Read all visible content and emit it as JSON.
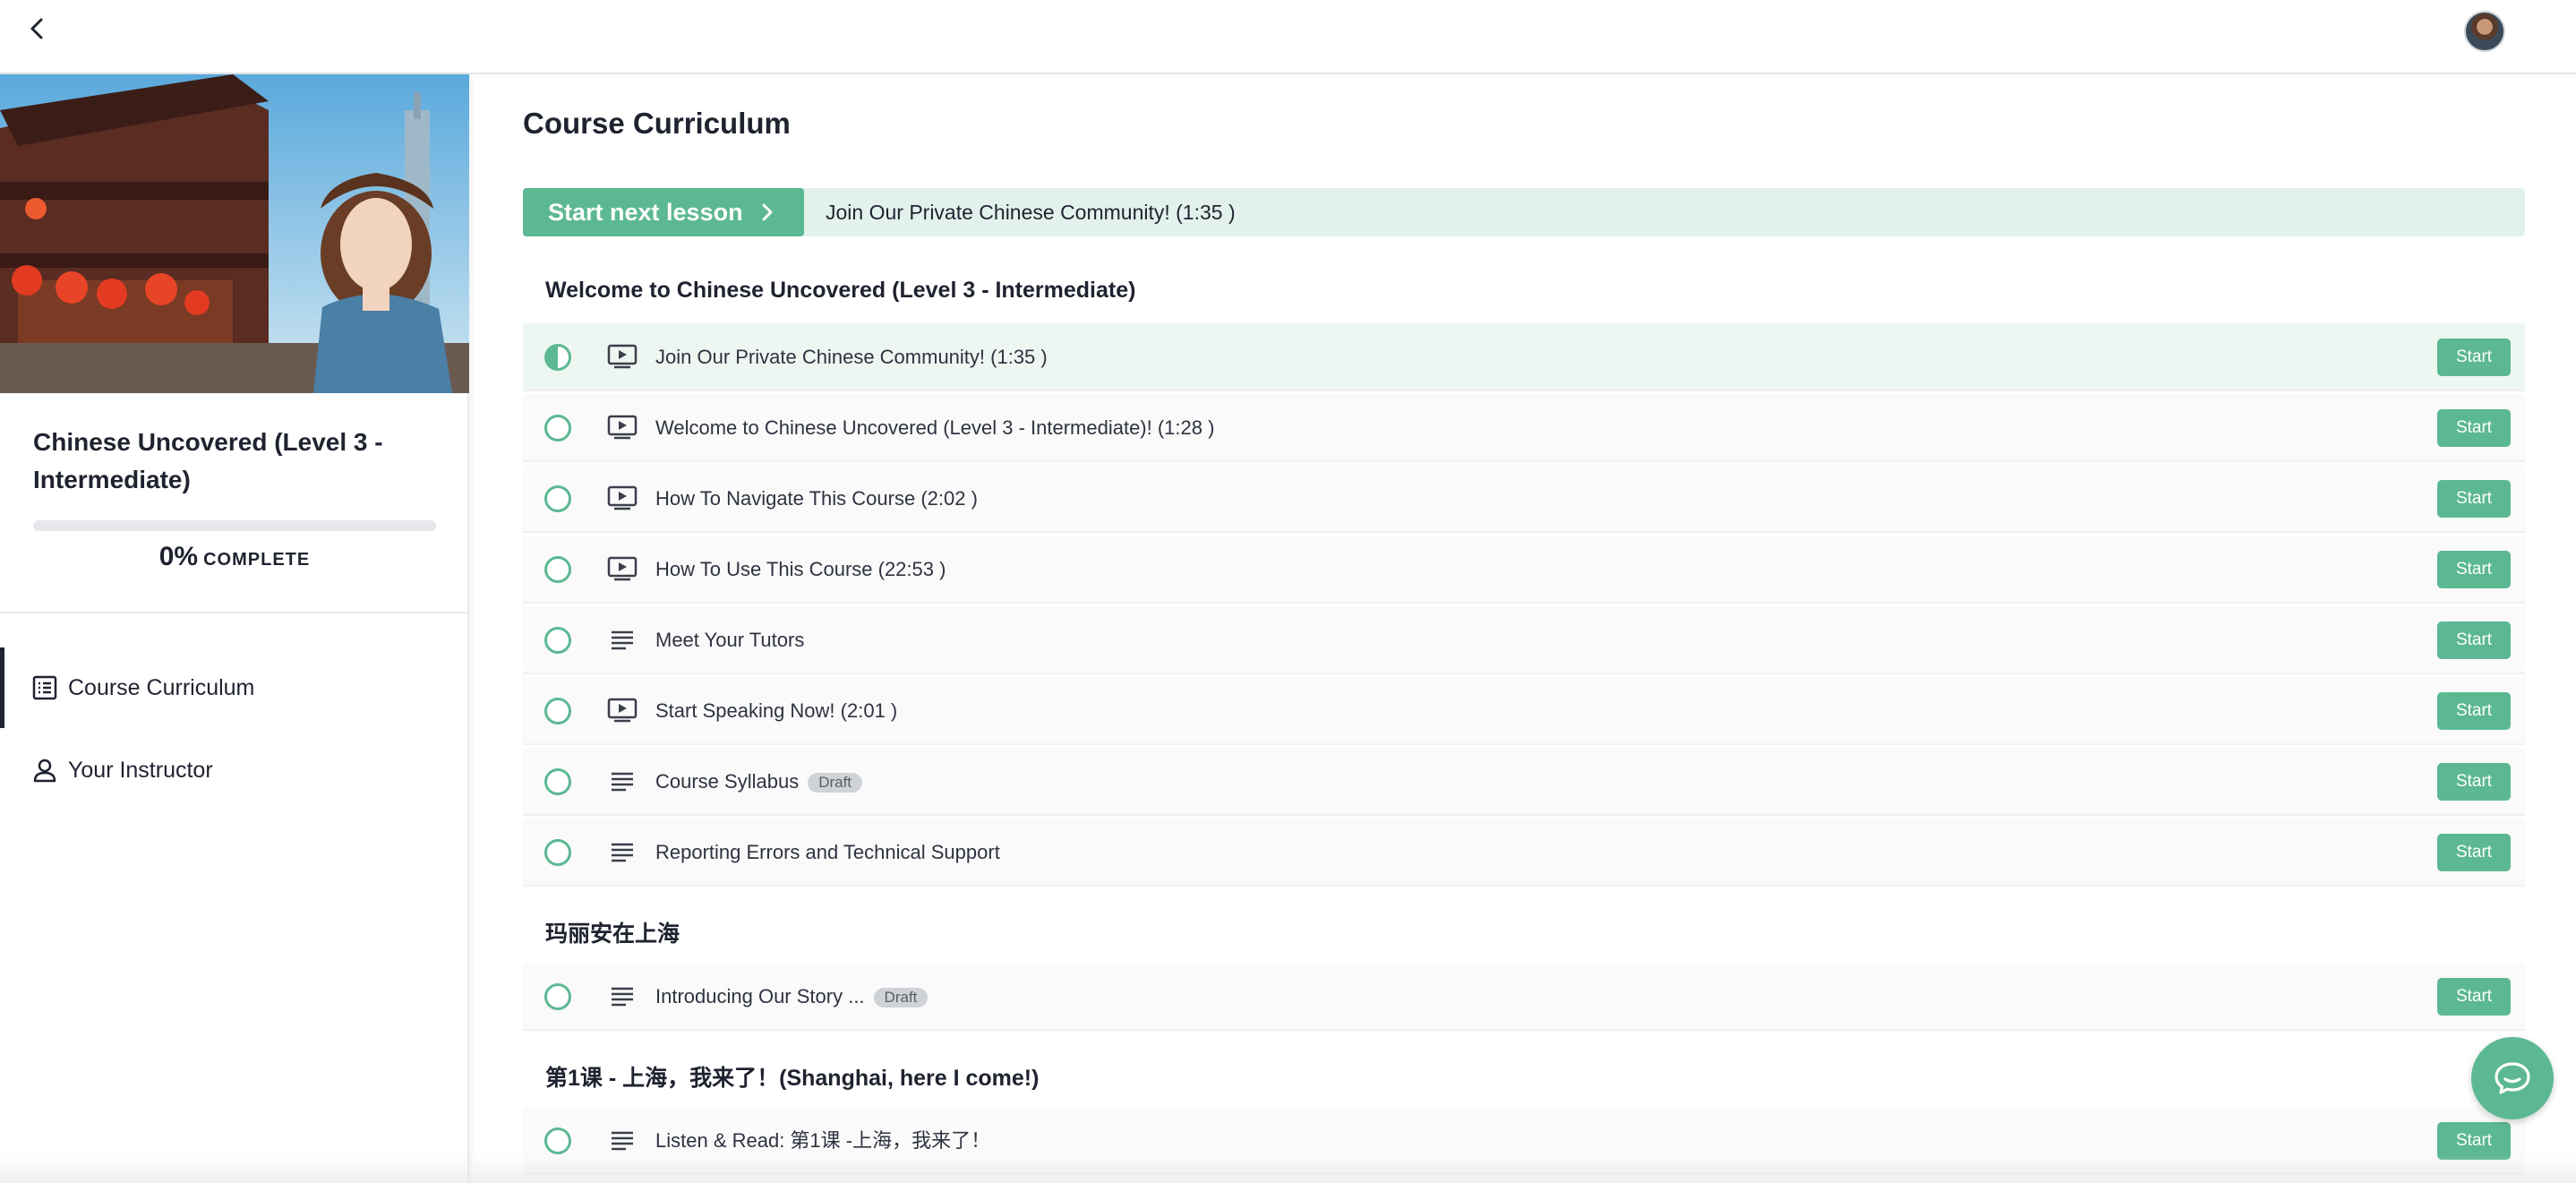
{
  "topbar": {
    "back_icon": "chevron-left-icon",
    "avatar_icon": "user-avatar"
  },
  "sidebar": {
    "course_title": "Chinese Uncovered (Level 3 - Intermediate)",
    "progress": {
      "percent": 0,
      "percent_label": "0%",
      "complete_label": "COMPLETE"
    },
    "nav": [
      {
        "label": "Course Curriculum",
        "icon": "list-icon",
        "active": true
      },
      {
        "label": "Your Instructor",
        "icon": "user-icon",
        "active": false
      }
    ]
  },
  "main": {
    "title": "Course Curriculum",
    "next_lesson": {
      "button_label": "Start next lesson",
      "lesson_title": "Join Our Private Chinese Community! (1:35 )"
    },
    "sections": [
      {
        "title": "Welcome to Chinese Uncovered (Level 3 - Intermediate)",
        "lessons": [
          {
            "name": "Join Our Private Chinese Community! (1:35 )",
            "type": "video",
            "status": "in-progress",
            "action": "Start",
            "draft": ""
          },
          {
            "name": "Welcome to Chinese Uncovered (Level 3 - Intermediate)! (1:28 )",
            "type": "video",
            "status": "not-started",
            "action": "Start",
            "draft": ""
          },
          {
            "name": "How To Navigate This Course (2:02 )",
            "type": "video",
            "status": "not-started",
            "action": "Start",
            "draft": ""
          },
          {
            "name": "How To Use This Course (22:53 )",
            "type": "video",
            "status": "not-started",
            "action": "Start",
            "draft": ""
          },
          {
            "name": "Meet Your Tutors",
            "type": "text",
            "status": "not-started",
            "action": "Start",
            "draft": ""
          },
          {
            "name": "Start Speaking Now! (2:01 )",
            "type": "video",
            "status": "not-started",
            "action": "Start",
            "draft": ""
          },
          {
            "name": "Course Syllabus",
            "type": "text",
            "status": "not-started",
            "action": "Start",
            "draft": "Draft"
          },
          {
            "name": "Reporting Errors and Technical Support",
            "type": "text",
            "status": "not-started",
            "action": "Start",
            "draft": ""
          }
        ]
      },
      {
        "title": "玛丽安在上海",
        "lessons": [
          {
            "name": "Introducing Our Story ...",
            "type": "text",
            "status": "not-started",
            "action": "Start",
            "draft": "Draft"
          }
        ]
      },
      {
        "title": "第1课 - 上海，我来了！(Shanghai, here I come!)",
        "lessons": [
          {
            "name": "Listen & Read: 第1课 -上海，我来了！",
            "type": "text",
            "status": "not-started",
            "action": "Start",
            "draft": ""
          }
        ]
      }
    ]
  },
  "chat": {
    "icon": "chat-bubble-icon"
  },
  "colors": {
    "accent": "#5cb892",
    "accent_light": "#e2f1eb",
    "text": "#1f2330"
  }
}
